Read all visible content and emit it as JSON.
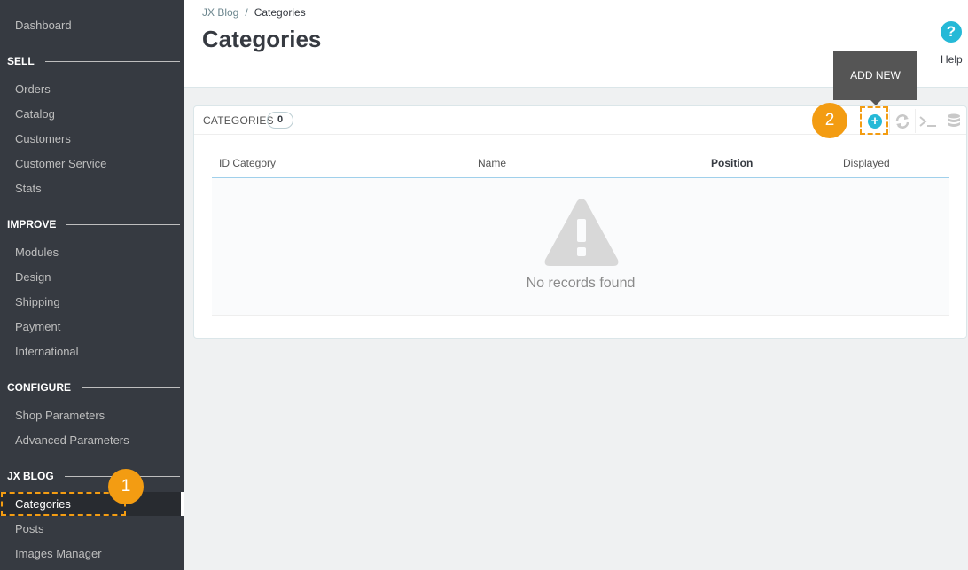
{
  "sidebar": {
    "dashboard": "Dashboard",
    "sections": [
      {
        "title": "SELL",
        "items": [
          "Orders",
          "Catalog",
          "Customers",
          "Customer Service",
          "Stats"
        ]
      },
      {
        "title": "IMPROVE",
        "items": [
          "Modules",
          "Design",
          "Shipping",
          "Payment",
          "International"
        ]
      },
      {
        "title": "CONFIGURE",
        "items": [
          "Shop Parameters",
          "Advanced Parameters"
        ]
      },
      {
        "title": "JX BLOG",
        "items": [
          "Categories",
          "Posts",
          "Images Manager"
        ]
      }
    ],
    "active_item": "Categories"
  },
  "header": {
    "breadcrumb": [
      "JX Blog",
      "Categories"
    ],
    "breadcrumb_separator": "/",
    "title": "Categories",
    "help_icon_glyph": "?",
    "help_label": "Help"
  },
  "tooltip": {
    "text": "ADD NEW"
  },
  "panel": {
    "title": "CATEGORIES",
    "count": "0",
    "toolbar": {
      "add_glyph": "+",
      "icons": [
        "add-new-icon",
        "refresh-icon",
        "terminal-icon",
        "database-icon"
      ]
    },
    "columns": [
      "ID Category",
      "Name",
      "Position",
      "Displayed"
    ],
    "empty_message": "No records found"
  },
  "callouts": [
    "1",
    "2"
  ],
  "colors": {
    "accent": "#25b9d7",
    "callout": "#f39c12",
    "sidebar": "#363a41"
  }
}
